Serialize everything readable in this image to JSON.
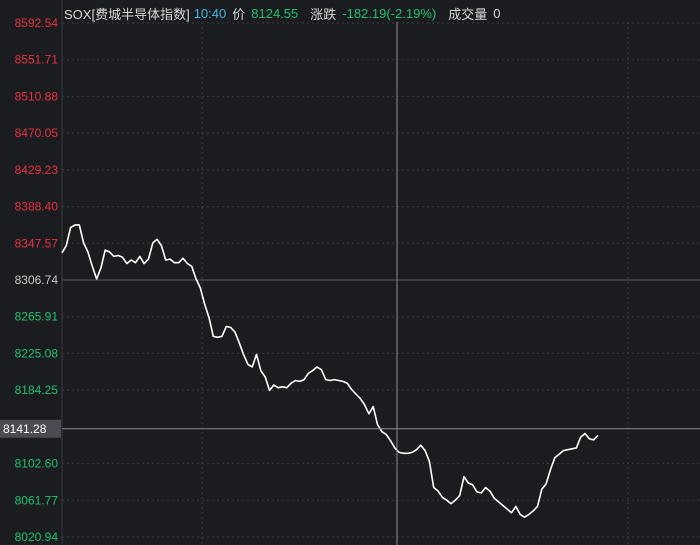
{
  "header": {
    "symbol": "SOX[费城半导体指数]",
    "time": "10:40",
    "price_label": "价",
    "price": "8124.55",
    "change_label": "涨跌",
    "change": "-182.19(-2.19%)",
    "volume_label": "成交量",
    "volume": "0"
  },
  "colors": {
    "background": "#1b1c20",
    "up": "#e8323c",
    "down": "#21c36f",
    "neutral": "#c8c8c8",
    "line": "#ffffff",
    "grid": "#3a3c42",
    "crosshair": "#8a8c92",
    "time": "#3fb8e8"
  },
  "chart_data": {
    "type": "line",
    "title": "",
    "xlabel": "",
    "ylabel": "",
    "ylim": [
      8000.0,
      8592.54
    ],
    "prev_close": 8306.74,
    "crosshair_value": 8141.28,
    "y_ticks": [
      {
        "label": "8592.54",
        "value": 8592.54,
        "color": "up"
      },
      {
        "label": "8551.71",
        "value": 8551.71,
        "color": "up"
      },
      {
        "label": "8510.88",
        "value": 8510.88,
        "color": "up"
      },
      {
        "label": "8470.05",
        "value": 8470.05,
        "color": "up"
      },
      {
        "label": "8429.23",
        "value": 8429.23,
        "color": "up"
      },
      {
        "label": "8388.40",
        "value": 8388.4,
        "color": "up"
      },
      {
        "label": "8347.57",
        "value": 8347.57,
        "color": "up"
      },
      {
        "label": "8306.74",
        "value": 8306.74,
        "color": "neutral"
      },
      {
        "label": "8265.91",
        "value": 8265.91,
        "color": "down"
      },
      {
        "label": "8225.08",
        "value": 8225.08,
        "color": "down"
      },
      {
        "label": "8184.25",
        "value": 8184.25,
        "color": "down"
      },
      {
        "label": "8102.60",
        "value": 8102.6,
        "color": "down"
      },
      {
        "label": "8061.77",
        "value": 8061.77,
        "color": "down"
      },
      {
        "label": "8020.94",
        "value": 8020.94,
        "color": "down"
      }
    ],
    "series": [
      {
        "values": [
          8337,
          8345,
          8365,
          8368,
          8368,
          8348,
          8338,
          8322,
          8308,
          8320,
          8340,
          8338,
          8333,
          8334,
          8332,
          8325,
          8329,
          8326,
          8333,
          8325,
          8330,
          8348,
          8352,
          8345,
          8329,
          8330,
          8326,
          8326,
          8331,
          8325,
          8322,
          8308,
          8298,
          8280,
          8265,
          8244,
          8243,
          8244,
          8255,
          8254,
          8249,
          8237,
          8224,
          8213,
          8210,
          8224,
          8206,
          8199,
          8184,
          8190,
          8187,
          8188,
          8187,
          8192,
          8195,
          8194,
          8196,
          8203,
          8206,
          8210,
          8207,
          8196,
          8195,
          8196,
          8195,
          8194,
          8192,
          8185,
          8180,
          8175,
          8168,
          8158,
          8166,
          8146,
          8138,
          8135,
          8128,
          8120,
          8115,
          8114,
          8114,
          8115,
          8118,
          8123,
          8117,
          8105,
          8076,
          8072,
          8065,
          8062,
          8058,
          8062,
          8067,
          8088,
          8081,
          8079,
          8071,
          8070,
          8076,
          8072,
          8064,
          8060,
          8056,
          8052,
          8048,
          8055,
          8046,
          8043,
          8046,
          8050,
          8055,
          8074,
          8080,
          8096,
          8109,
          8113,
          8117,
          8118,
          8119,
          8120,
          8132,
          8136,
          8130,
          8129,
          8134
        ]
      }
    ]
  }
}
